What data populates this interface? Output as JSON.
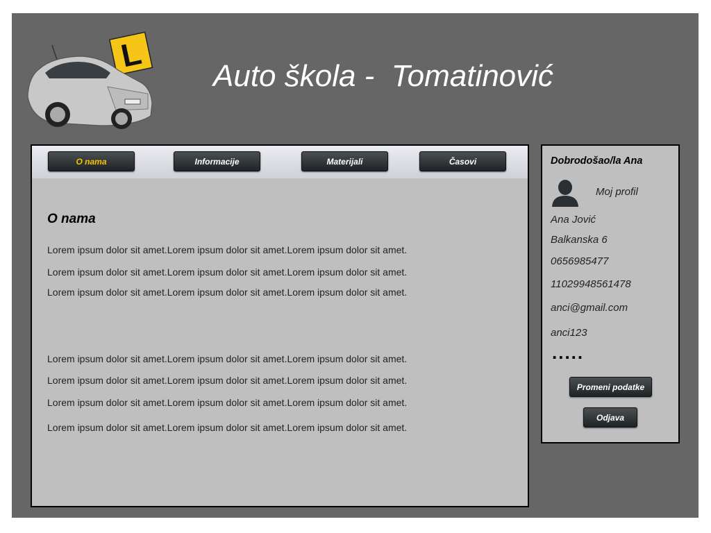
{
  "header": {
    "title": "Auto škola -  Tomatinović",
    "logo_sign": "L"
  },
  "nav": {
    "items": [
      {
        "label": "O nama",
        "active": true
      },
      {
        "label": "Informacije",
        "active": false
      },
      {
        "label": "Materijali",
        "active": false
      },
      {
        "label": "Časovi",
        "active": false
      }
    ]
  },
  "main": {
    "section_title": "O nama",
    "paragraphs": [
      "Lorem ipsum dolor sit amet.Lorem ipsum dolor sit amet.Lorem ipsum dolor sit amet.",
      "Lorem ipsum dolor sit amet.Lorem ipsum dolor sit amet.Lorem ipsum dolor sit amet.",
      "Lorem ipsum dolor sit amet.Lorem ipsum dolor sit amet.Lorem ipsum dolor sit amet.",
      "Lorem ipsum dolor sit amet.Lorem ipsum dolor sit amet.Lorem ipsum dolor sit amet.",
      "Lorem ipsum dolor sit amet.Lorem ipsum dolor sit amet.Lorem ipsum dolor sit amet.",
      "Lorem ipsum dolor sit amet.Lorem ipsum dolor sit amet.Lorem ipsum dolor sit amet.",
      "Lorem ipsum dolor sit amet.Lorem ipsum dolor sit amet.Lorem ipsum dolor sit amet."
    ]
  },
  "sidebar": {
    "welcome": "Dobrodošao/la Ana",
    "profile_link": "Moj profil",
    "user": {
      "name": "Ana Jović",
      "address": "Balkanska 6",
      "phone": "0656985477",
      "jmbg": "11029948561478",
      "email": "anci@gmail.com",
      "username": "anci123",
      "password_mask": "....."
    },
    "change_button": "Promeni podatke",
    "logout_button": "Odjava"
  },
  "colors": {
    "frame": "#666666",
    "panel": "#bfbfbf",
    "active_nav": "#f7c400",
    "button": "#2b2f31"
  }
}
